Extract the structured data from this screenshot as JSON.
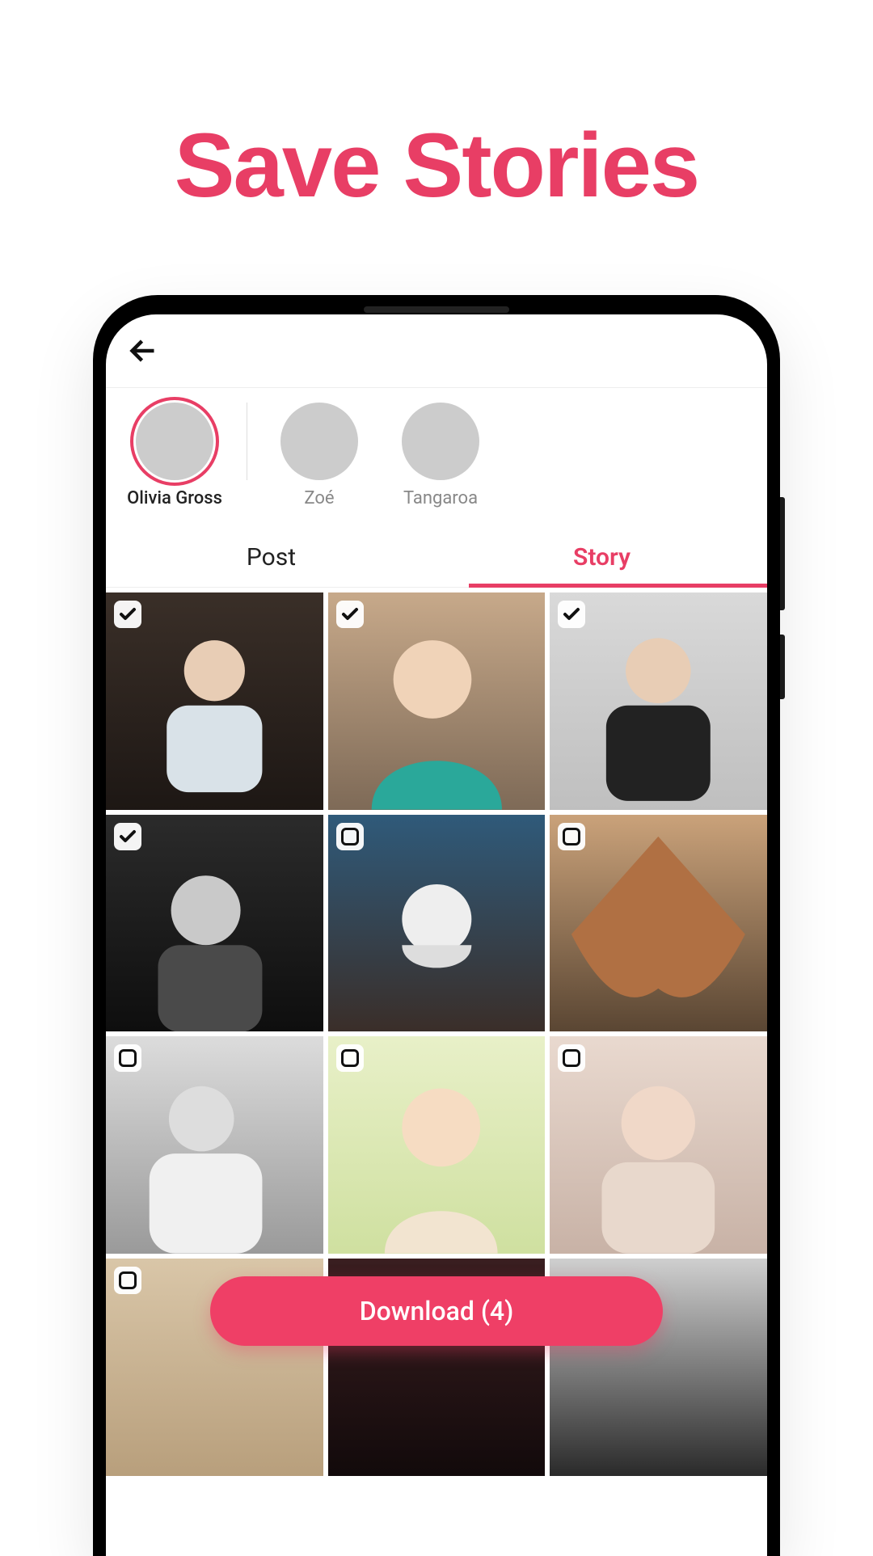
{
  "hero": {
    "title": "Save Stories"
  },
  "colors": {
    "accent": "#e83e65"
  },
  "topbar": {
    "back_aria": "Back"
  },
  "users": [
    {
      "name": "Olivia Gross",
      "active": true
    },
    {
      "name": "Zoé",
      "active": false
    },
    {
      "name": "Tangaroa",
      "active": false
    }
  ],
  "tabs": {
    "post": {
      "label": "Post",
      "active": false
    },
    "story": {
      "label": "Story",
      "active": true
    }
  },
  "grid": {
    "items": [
      {
        "selected": true
      },
      {
        "selected": true
      },
      {
        "selected": true
      },
      {
        "selected": true
      },
      {
        "selected": false
      },
      {
        "selected": false
      },
      {
        "selected": false
      },
      {
        "selected": false
      },
      {
        "selected": false
      },
      {
        "selected": false
      },
      {
        "selected": false
      },
      {
        "selected": false
      }
    ]
  },
  "download": {
    "label": "Download (4)",
    "count": 4
  }
}
